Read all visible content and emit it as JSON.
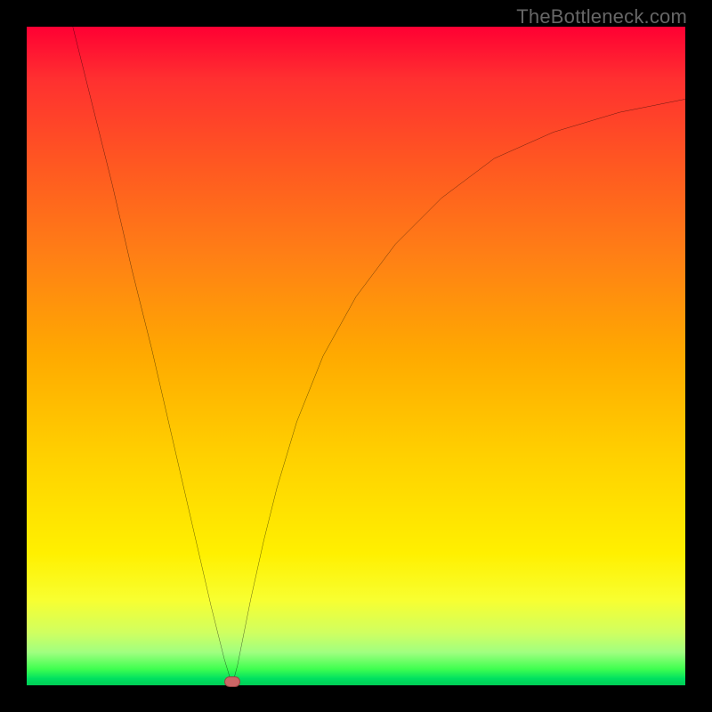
{
  "watermark": "TheBottleneck.com",
  "chart_data": {
    "type": "line",
    "title": "",
    "xlabel": "",
    "ylabel": "",
    "xlim": [
      0,
      100
    ],
    "ylim": [
      0,
      100
    ],
    "x": [
      7,
      10,
      13,
      16,
      19,
      22,
      25,
      28,
      30,
      31.2,
      32,
      33,
      34,
      36,
      38,
      41,
      45,
      50,
      56,
      63,
      71,
      80,
      90,
      100
    ],
    "y": [
      100,
      88,
      76,
      63,
      51,
      38,
      25,
      12,
      4,
      0,
      3,
      8,
      13,
      22,
      30,
      40,
      50,
      59,
      67,
      74,
      80,
      84,
      87,
      89
    ],
    "annotations": [
      {
        "type": "marker",
        "x": 31.2,
        "y": 0.5,
        "color": "#cc6666"
      }
    ],
    "grid": false,
    "legend": false
  },
  "colors": {
    "background_frame": "#000000",
    "curve": "#000000",
    "marker": "#cc6666",
    "watermark": "#666666"
  }
}
